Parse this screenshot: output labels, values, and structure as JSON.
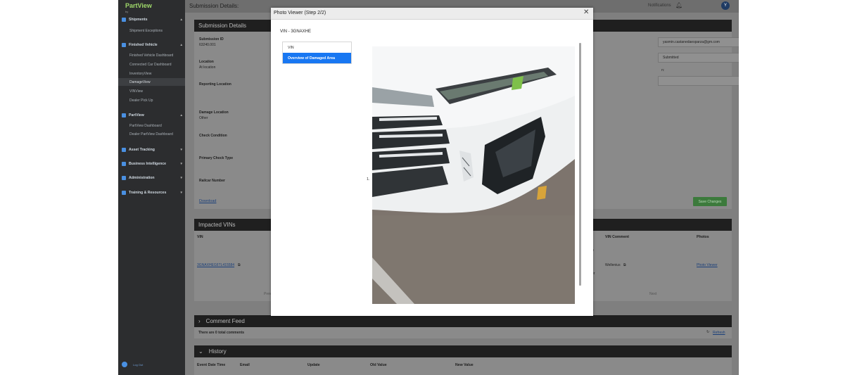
{
  "app": {
    "logo_text": "PartView",
    "logo_by": "by",
    "page_title": "Submission Details:"
  },
  "topbar": {
    "notifications_label": "Notifications",
    "avatar_initial": "Y"
  },
  "sidebar": {
    "sections": [
      {
        "label": "Shipments",
        "items": [
          {
            "label": "Shipment Exceptions"
          }
        ]
      },
      {
        "label": "Finished Vehicle",
        "items": [
          {
            "label": "Finished Vehicle Dashboard"
          },
          {
            "label": "Connected Car Dashboard"
          },
          {
            "label": "InventoryView"
          },
          {
            "label": "DamageView",
            "active": true
          },
          {
            "label": "VINView"
          },
          {
            "label": "Dealer Pick Up"
          }
        ]
      },
      {
        "label": "PartView",
        "items": [
          {
            "label": "PartView Dashboard"
          },
          {
            "label": "Dealer PartView Dashboard"
          }
        ]
      },
      {
        "label": "Asset Tracking",
        "items": []
      },
      {
        "label": "Business Intelligence",
        "items": []
      },
      {
        "label": "Administration",
        "items": []
      },
      {
        "label": "Training & Resources",
        "items": []
      }
    ],
    "logout_label": "Log Out"
  },
  "submission": {
    "header": "Submission Details",
    "fields": [
      {
        "label": "Submission ID",
        "value": "63240.001"
      },
      {
        "label": "Location",
        "value": "At location"
      },
      {
        "label": "Reporting Location",
        "value": ""
      },
      {
        "label": "Damage Location",
        "value": "Other"
      },
      {
        "label": "Check Condition",
        "value": ""
      },
      {
        "label": "Primary Chock Type",
        "value": ""
      },
      {
        "label": "Railcar Number",
        "value": ""
      }
    ],
    "download_label": "Download",
    "assignee_email": "yasmin.castanedaesparza@gm.com",
    "status_value": "Submitted",
    "right_label": "n:",
    "save_label": "Save Changes"
  },
  "impacted": {
    "header": "Impacted VINs",
    "columns": {
      "vin": "VIN",
      "comment": "VIN Comment",
      "photos": "Photos"
    },
    "row": {
      "vin": "3GNAXHEG6TL415584",
      "comment": "Wellenius",
      "photos_link": "Photo Viewer",
      "frag1": "p",
      "frag2": "er"
    },
    "pager": {
      "prev": "Prev",
      "next": "Next"
    }
  },
  "comment_feed": {
    "header": "Comment Feed",
    "count_text": "There are 0 total comments",
    "refresh_label": "Refresh"
  },
  "history": {
    "header": "History",
    "columns": [
      "Event Date Time",
      "Email",
      "Update",
      "Old Value",
      "New Value"
    ]
  },
  "modal": {
    "title": "Photo Viewer (Step 2/2)",
    "vin_label": "VIN - 3GNAXHE",
    "menu": [
      {
        "label": "VIN"
      },
      {
        "label": "Overview of Damaged Area",
        "selected": true
      }
    ],
    "photo_index": "1.",
    "close_glyph": "✕"
  },
  "colors": {
    "accent": "#1877f2",
    "logo": "#9fd86a",
    "header_bar": "#1f1f1f",
    "save_button": "#3c7a3c"
  },
  "icons": [
    "bell-icon",
    "close-icon",
    "copy-icon",
    "refresh-icon",
    "chevron-icon",
    "logout-icon"
  ]
}
